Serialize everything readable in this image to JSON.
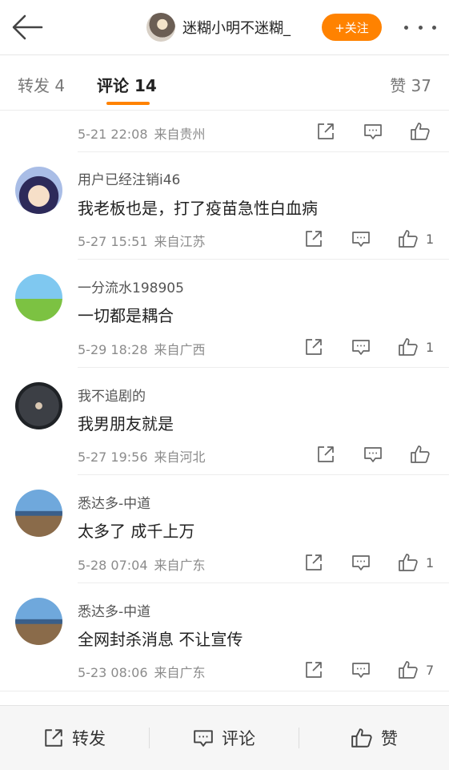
{
  "header": {
    "author_name": "迷糊小明不迷糊_",
    "follow_label": "+关注",
    "icons": {
      "back": "back-arrow-icon",
      "more": "more-dots-icon"
    }
  },
  "tabs": {
    "repost": "转发 4",
    "comment": "评论 14",
    "like": "赞 37",
    "accent_color": "#ff8200"
  },
  "comments": [
    {
      "time": "5-21 22:08",
      "location": "来自贵州",
      "likes": ""
    },
    {
      "user": "用户已经注销i46",
      "text": "我老板也是，打了疫苗急性白血病",
      "time": "5-27 15:51",
      "location": "来自江苏",
      "likes": "1"
    },
    {
      "user": "一分流水198905",
      "text": "一切都是耦合",
      "time": "5-29 18:28",
      "location": "来自广西",
      "likes": "1"
    },
    {
      "user": "我不追剧的",
      "text": "我男朋友就是",
      "time": "5-27 19:56",
      "location": "来自河北",
      "likes": ""
    },
    {
      "user": "悉达多-中道",
      "text": "太多了 成千上万",
      "time": "5-28 07:04",
      "location": "来自广东",
      "likes": "1"
    },
    {
      "user": "悉达多-中道",
      "text": "全网封杀消息 不让宣传",
      "time": "5-23 08:06",
      "location": "来自广东",
      "likes": "7"
    }
  ],
  "bottom_bar": {
    "repost_label": "转发",
    "comment_label": "评论",
    "like_label": "赞"
  }
}
